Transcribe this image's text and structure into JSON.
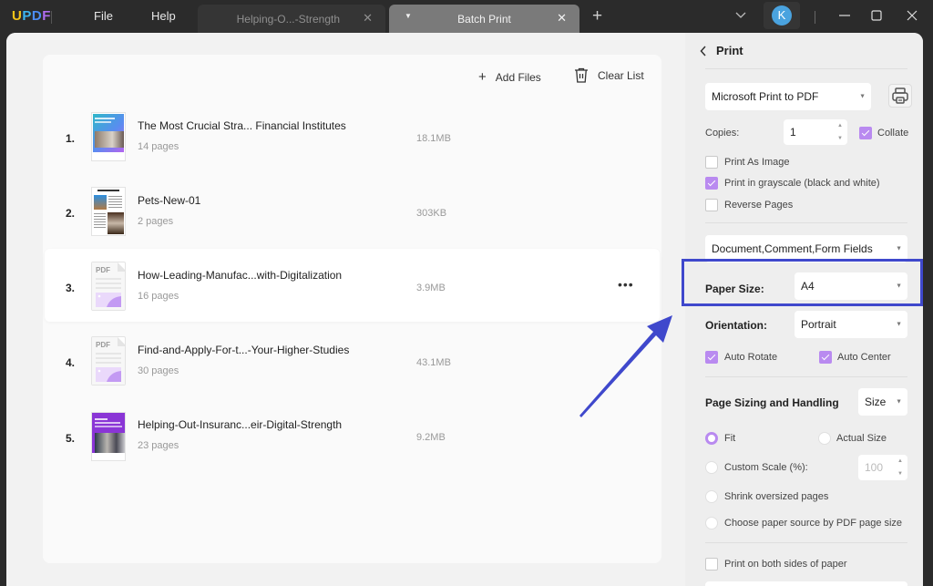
{
  "app": {
    "logo": {
      "u": "U",
      "p": "P",
      "d": "D",
      "f": "F"
    },
    "menu": [
      "File",
      "Help"
    ],
    "tabs": [
      {
        "label": "Helping-O...-Strength",
        "active": false
      },
      {
        "label": "Batch Print",
        "active": true
      }
    ],
    "avatar_initial": "K",
    "accent_color": "#b98af0",
    "annotation_color": "#3f48cc"
  },
  "file_list": {
    "toolbar": {
      "add_files": "Add Files",
      "clear_list": "Clear List"
    },
    "files": [
      {
        "index": "1.",
        "name": "The Most Crucial Stra... Financial Institutes",
        "pages": "14 pages",
        "size": "18.1MB",
        "thumb": "cover-gradient"
      },
      {
        "index": "2.",
        "name": "Pets-New-01",
        "pages": "2 pages",
        "size": "303KB",
        "thumb": "cover-pets"
      },
      {
        "index": "3.",
        "name": "How-Leading-Manufac...with-Digitalization",
        "pages": "16 pages",
        "size": "3.9MB",
        "thumb": "pdf-placeholder"
      },
      {
        "index": "4.",
        "name": "Find-and-Apply-For-t...-Your-Higher-Studies",
        "pages": "30 pages",
        "size": "43.1MB",
        "thumb": "pdf-placeholder"
      },
      {
        "index": "5.",
        "name": "Helping-Out-Insuranc...eir-Digital-Strength",
        "pages": "23 pages",
        "size": "9.2MB",
        "thumb": "cover-purple"
      }
    ],
    "pdf_placeholder_label": "PDF",
    "more_label": "•••"
  },
  "print_panel": {
    "title": "Print",
    "printer": "Microsoft Print to PDF",
    "copies_label": "Copies:",
    "copies_value": "1",
    "collate": {
      "label": "Collate",
      "checked": true
    },
    "options": [
      {
        "label": "Print As Image",
        "checked": false
      },
      {
        "label": "Print in grayscale (black and white)",
        "checked": true
      },
      {
        "label": "Reverse Pages",
        "checked": false
      }
    ],
    "content": "Document,Comment,Form Fields",
    "paper_size_label": "Paper Size:",
    "paper_size": "A4",
    "orientation_label": "Orientation:",
    "orientation": "Portrait",
    "auto_rotate": {
      "label": "Auto Rotate",
      "checked": true
    },
    "auto_center": {
      "label": "Auto Center",
      "checked": true
    },
    "sizing_title": "Page Sizing and Handling",
    "sizing_mode": "Size",
    "sizing_options": {
      "fit": {
        "label": "Fit",
        "checked": true
      },
      "actual": {
        "label": "Actual Size",
        "checked": false
      },
      "custom": {
        "label": "Custom Scale (%):",
        "checked": false
      },
      "custom_value": "100",
      "shrink": {
        "label": "Shrink oversized pages",
        "checked": false
      },
      "paper_source": {
        "label": "Choose paper source by PDF page size",
        "checked": false
      }
    },
    "duplex": {
      "label": "Print on both sides of paper",
      "checked": false
    }
  }
}
